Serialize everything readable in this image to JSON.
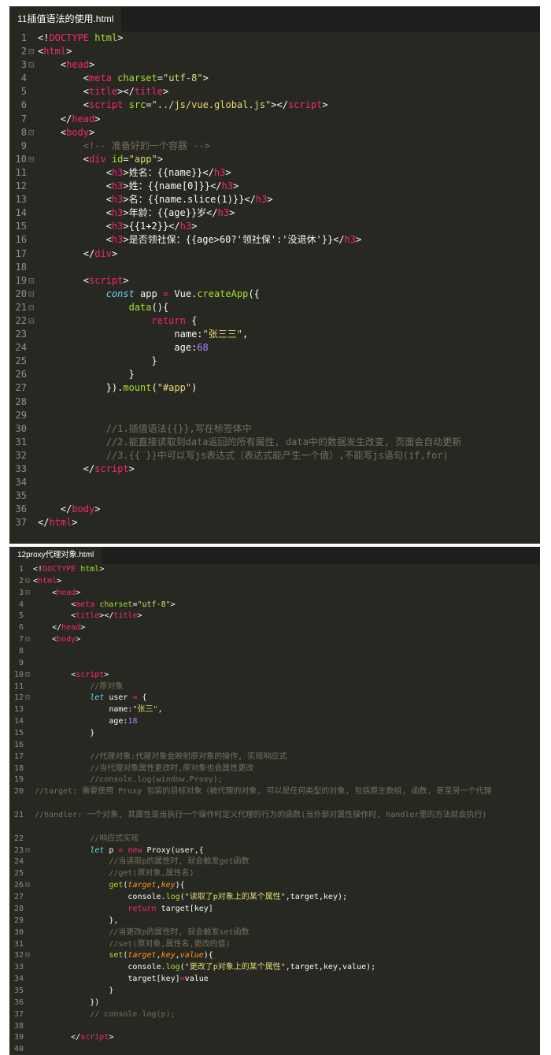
{
  "colors": {
    "background": "#272822",
    "tag": "#f92672",
    "attr": "#a6e22e",
    "string": "#e6db74",
    "comment": "#75715e",
    "keyword": "#66d9ef",
    "number": "#ae81ff",
    "param": "#fd971f"
  },
  "editor1": {
    "tab": "11插值语法的使用.html",
    "lines": [
      [
        [
          "w",
          "<!"
        ],
        [
          "t",
          "DOCTYPE"
        ],
        [
          "w",
          " "
        ],
        [
          "a",
          "html"
        ],
        [
          "w",
          ">"
        ]
      ],
      [
        [
          "w",
          "<"
        ],
        [
          "t",
          "html"
        ],
        [
          "w",
          ">"
        ]
      ],
      [
        [
          "w",
          "    <"
        ],
        [
          "t",
          "head"
        ],
        [
          "w",
          ">"
        ]
      ],
      [
        [
          "w",
          "        <"
        ],
        [
          "t",
          "meta"
        ],
        [
          "w",
          " "
        ],
        [
          "a",
          "charset"
        ],
        [
          "w",
          "="
        ],
        [
          "s",
          "\"utf-8\""
        ],
        [
          "w",
          ">"
        ]
      ],
      [
        [
          "w",
          "        <"
        ],
        [
          "t",
          "title"
        ],
        [
          "w",
          "></"
        ],
        [
          "t",
          "title"
        ],
        [
          "w",
          ">"
        ]
      ],
      [
        [
          "w",
          "        <"
        ],
        [
          "t",
          "script"
        ],
        [
          "w",
          " "
        ],
        [
          "a",
          "src"
        ],
        [
          "w",
          "="
        ],
        [
          "s",
          "\"../js/vue.global.js\""
        ],
        [
          "w",
          "></"
        ],
        [
          "t",
          "script"
        ],
        [
          "w",
          ">"
        ]
      ],
      [
        [
          "w",
          "    </"
        ],
        [
          "t",
          "head"
        ],
        [
          "w",
          ">"
        ]
      ],
      [
        [
          "w",
          "    <"
        ],
        [
          "t",
          "body"
        ],
        [
          "w",
          ">"
        ]
      ],
      [
        [
          "c",
          "        <!-- 准备好的一个容器 -->"
        ]
      ],
      [
        [
          "w",
          "        <"
        ],
        [
          "t",
          "div"
        ],
        [
          "w",
          " "
        ],
        [
          "a",
          "id"
        ],
        [
          "w",
          "="
        ],
        [
          "s",
          "\"app\""
        ],
        [
          "w",
          ">"
        ]
      ],
      [
        [
          "w",
          "            <"
        ],
        [
          "t",
          "h3"
        ],
        [
          "w",
          ">姓名：{{name}}</"
        ],
        [
          "t",
          "h3"
        ],
        [
          "w",
          ">"
        ]
      ],
      [
        [
          "w",
          "            <"
        ],
        [
          "t",
          "h3"
        ],
        [
          "w",
          ">姓：{{name[0]}}</"
        ],
        [
          "t",
          "h3"
        ],
        [
          "w",
          ">"
        ]
      ],
      [
        [
          "w",
          "            <"
        ],
        [
          "t",
          "h3"
        ],
        [
          "w",
          ">名：{{name.slice(1)}}</"
        ],
        [
          "t",
          "h3"
        ],
        [
          "w",
          ">"
        ]
      ],
      [
        [
          "w",
          "            <"
        ],
        [
          "t",
          "h3"
        ],
        [
          "w",
          ">年龄：{{age}}岁</"
        ],
        [
          "t",
          "h3"
        ],
        [
          "w",
          ">"
        ]
      ],
      [
        [
          "w",
          "            <"
        ],
        [
          "t",
          "h3"
        ],
        [
          "w",
          ">{{1+2}}</"
        ],
        [
          "t",
          "h3"
        ],
        [
          "w",
          ">"
        ]
      ],
      [
        [
          "w",
          "            <"
        ],
        [
          "t",
          "h3"
        ],
        [
          "w",
          ">是否领社保：{{age>60?'领社保':'没退休'}}</"
        ],
        [
          "t",
          "h3"
        ],
        [
          "w",
          ">"
        ]
      ],
      [
        [
          "w",
          "        </"
        ],
        [
          "t",
          "div"
        ],
        [
          "w",
          ">"
        ]
      ],
      [
        [
          "w",
          ""
        ]
      ],
      [
        [
          "w",
          "        <"
        ],
        [
          "t",
          "script"
        ],
        [
          "w",
          ">"
        ]
      ],
      [
        [
          "w",
          "            "
        ],
        [
          "k",
          "const"
        ],
        [
          "w",
          " app "
        ],
        [
          "r",
          "="
        ],
        [
          "w",
          " Vue."
        ],
        [
          "f",
          "createApp"
        ],
        [
          "w",
          "({"
        ]
      ],
      [
        [
          "w",
          "                "
        ],
        [
          "f",
          "data"
        ],
        [
          "w",
          "(){"
        ]
      ],
      [
        [
          "w",
          "                    "
        ],
        [
          "r",
          "return"
        ],
        [
          "w",
          " {"
        ]
      ],
      [
        [
          "w",
          "                        name:"
        ],
        [
          "s",
          "\"张三三\""
        ],
        [
          "w",
          ","
        ]
      ],
      [
        [
          "w",
          "                        age:"
        ],
        [
          "n",
          "68"
        ]
      ],
      [
        [
          "w",
          "                    }"
        ]
      ],
      [
        [
          "w",
          "                }"
        ]
      ],
      [
        [
          "w",
          "            })."
        ],
        [
          "f",
          "mount"
        ],
        [
          "w",
          "("
        ],
        [
          "s",
          "\"#app\""
        ],
        [
          "w",
          ")"
        ]
      ],
      [
        [
          "w",
          ""
        ]
      ],
      [
        [
          "w",
          ""
        ]
      ],
      [
        [
          "c",
          "            //1.插值语法{{}},写在标签体中"
        ]
      ],
      [
        [
          "c",
          "            //2.能直接读取到data返回的所有属性, data中的数据发生改变, 页面会自动更新"
        ]
      ],
      [
        [
          "c",
          "            //3.{{ }}中可以写js表达式（表达式能产生一个值）,不能写js语句(if,for)"
        ]
      ],
      [
        [
          "w",
          "        </"
        ],
        [
          "t",
          "script"
        ],
        [
          "w",
          ">"
        ]
      ],
      [
        [
          "w",
          ""
        ]
      ],
      [
        [
          "w",
          ""
        ]
      ],
      [
        [
          "w",
          "    </"
        ],
        [
          "t",
          "body"
        ],
        [
          "w",
          ">"
        ]
      ],
      [
        [
          "w",
          "</"
        ],
        [
          "t",
          "html"
        ],
        [
          "w",
          ">"
        ]
      ]
    ]
  },
  "editor2": {
    "tab": "12proxy代理对象.html",
    "lines": [
      [
        [
          "w",
          "<!"
        ],
        [
          "t",
          "DOCTYPE"
        ],
        [
          "w",
          " "
        ],
        [
          "a",
          "html"
        ],
        [
          "w",
          ">"
        ]
      ],
      [
        [
          "w",
          "<"
        ],
        [
          "t",
          "html"
        ],
        [
          "w",
          ">"
        ]
      ],
      [
        [
          "w",
          "    <"
        ],
        [
          "t",
          "head"
        ],
        [
          "w",
          ">"
        ]
      ],
      [
        [
          "w",
          "        <"
        ],
        [
          "t",
          "meta"
        ],
        [
          "w",
          " "
        ],
        [
          "a",
          "charset"
        ],
        [
          "w",
          "="
        ],
        [
          "s",
          "\"utf-8\""
        ],
        [
          "w",
          ">"
        ]
      ],
      [
        [
          "w",
          "        <"
        ],
        [
          "t",
          "title"
        ],
        [
          "w",
          "></"
        ],
        [
          "t",
          "title"
        ],
        [
          "w",
          ">"
        ]
      ],
      [
        [
          "w",
          "    </"
        ],
        [
          "t",
          "head"
        ],
        [
          "w",
          ">"
        ]
      ],
      [
        [
          "w",
          "    <"
        ],
        [
          "t",
          "body"
        ],
        [
          "w",
          ">"
        ]
      ],
      [
        [
          "w",
          ""
        ]
      ],
      [
        [
          "w",
          ""
        ]
      ],
      [
        [
          "w",
          "        <"
        ],
        [
          "t",
          "script"
        ],
        [
          "w",
          ">"
        ]
      ],
      [
        [
          "c",
          "            //原对象"
        ]
      ],
      [
        [
          "w",
          "            "
        ],
        [
          "k",
          "let"
        ],
        [
          "w",
          " user "
        ],
        [
          "r",
          "="
        ],
        [
          "w",
          " {"
        ]
      ],
      [
        [
          "w",
          "                name:"
        ],
        [
          "s",
          "\"张三\""
        ],
        [
          "w",
          ","
        ]
      ],
      [
        [
          "w",
          "                age:"
        ],
        [
          "n",
          "18"
        ]
      ],
      [
        [
          "w",
          "            }"
        ]
      ],
      [
        [
          "w",
          ""
        ]
      ],
      [
        [
          "c",
          "            //代理对象:代理对象会映射原对象的操作, 实现响应式"
        ]
      ],
      [
        [
          "c",
          "            //当代理对象属性更改时,原对象也会属性更改"
        ]
      ],
      [
        [
          "c",
          "            //console.log(window.Proxy);"
        ]
      ],
      [
        [
          "c",
          "            //target: 需要使用 Proxy 包装的目标对象（被代理的对象, 可以是任何类型的对象, 包括原生数组, 函数, 甚至另一个代理"
        ]
      ],
      [
        [
          "c",
          "            //handler: 一个对象, 其属性是当执行一个操作时定义代理的行为的函数(当外部对属性操作时, handler里的方法就会执行)"
        ]
      ],
      [
        [
          "c",
          "            //响应式实现"
        ]
      ],
      [
        [
          "w",
          "            "
        ],
        [
          "k",
          "let"
        ],
        [
          "w",
          " p "
        ],
        [
          "r",
          "="
        ],
        [
          "w",
          " "
        ],
        [
          "r",
          "new"
        ],
        [
          "w",
          " Proxy(user,{"
        ]
      ],
      [
        [
          "c",
          "                //当读取p的属性时, 就会触发get函数"
        ]
      ],
      [
        [
          "c",
          "                //get(原对象,属性名)"
        ]
      ],
      [
        [
          "w",
          "                "
        ],
        [
          "f",
          "get"
        ],
        [
          "w",
          "("
        ],
        [
          "p",
          "target"
        ],
        [
          "w",
          ","
        ],
        [
          "p",
          "key"
        ],
        [
          "w",
          "){"
        ]
      ],
      [
        [
          "w",
          "                    console."
        ],
        [
          "f",
          "log"
        ],
        [
          "w",
          "("
        ],
        [
          "s",
          "\"读取了p对象上的某个属性\""
        ],
        [
          "w",
          ",target,key);"
        ]
      ],
      [
        [
          "w",
          "                    "
        ],
        [
          "r",
          "return"
        ],
        [
          "w",
          " target[key]"
        ]
      ],
      [
        [
          "w",
          "                },"
        ]
      ],
      [
        [
          "c",
          "                //当更改p的属性时, 就会触发set函数"
        ]
      ],
      [
        [
          "c",
          "                //set(原对象,属性名,更改的值)"
        ]
      ],
      [
        [
          "w",
          "                "
        ],
        [
          "f",
          "set"
        ],
        [
          "w",
          "("
        ],
        [
          "p",
          "target"
        ],
        [
          "w",
          ","
        ],
        [
          "p",
          "key"
        ],
        [
          "w",
          ","
        ],
        [
          "p",
          "value"
        ],
        [
          "w",
          "){"
        ]
      ],
      [
        [
          "w",
          "                    console."
        ],
        [
          "f",
          "log"
        ],
        [
          "w",
          "("
        ],
        [
          "s",
          "\"更改了p对象上的某个属性\""
        ],
        [
          "w",
          ",target,key,value);"
        ]
      ],
      [
        [
          "w",
          "                    target[key]"
        ],
        [
          "r",
          "="
        ],
        [
          "w",
          "value"
        ]
      ],
      [
        [
          "w",
          "                }"
        ]
      ],
      [
        [
          "w",
          "            })"
        ]
      ],
      [
        [
          "c",
          "            // console.log(p);"
        ]
      ],
      [
        [
          "w",
          ""
        ]
      ],
      [
        [
          "w",
          "        </"
        ],
        [
          "t",
          "script"
        ],
        [
          "w",
          ">"
        ]
      ],
      [
        [
          "w",
          ""
        ]
      ]
    ]
  }
}
